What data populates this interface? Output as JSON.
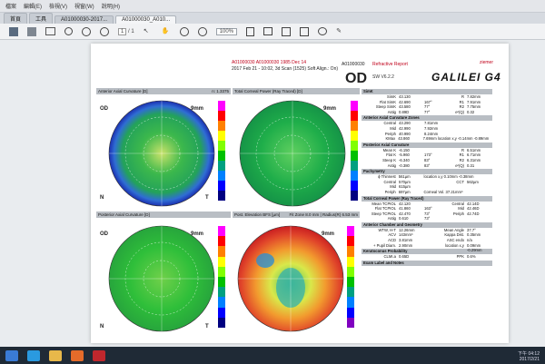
{
  "menu": {
    "items": [
      "檔案",
      "編輯(E)",
      "檢視(V)",
      "視窗(W)",
      "說明(H)"
    ]
  },
  "tabs": [
    {
      "label": "首頁"
    },
    {
      "label": "工具"
    },
    {
      "label": "A01000030-2017..."
    },
    {
      "label": "A01000030_A010..."
    }
  ],
  "toolbar": {
    "zoom_value": "100%",
    "page_current": "1",
    "page_total": "1"
  },
  "header": {
    "patient_line1": "A01000030 A01000030 1985 Dec 14",
    "patient_line2": "2017 Feb 21 - 10:02, 3d Scan (1525) Soft Align.: On)",
    "patient_id": "A01000030",
    "report_title": "Refractive Report",
    "eye": "OD",
    "sw_version": "SW V6.2.2",
    "brand": "GALILEI G4",
    "brand_sub": "ziemer"
  },
  "panels": [
    {
      "title": "Anterior Axial Curvature [D]",
      "tr": "n: 1.3375",
      "left": "OD",
      "right": "9mm",
      "bottom_left": "N",
      "bottom_right": "T"
    },
    {
      "title": "Total Corneal Power (Ray Traced) [D]",
      "tr": "",
      "left": "",
      "right": "9mm",
      "bottom_left": "",
      "bottom_right": ""
    },
    {
      "title": "Posterior Axial Curvature [D]",
      "tr": "",
      "left": "OD",
      "right": "9mm",
      "bottom_left": "N",
      "bottom_right": "T"
    },
    {
      "title": "Post. Elevation BFS [µm]",
      "tr": "Fit Zone 8.0 mm | Radius(R) 6.53 mm",
      "left": "",
      "right": "9mm",
      "bottom_left": "",
      "bottom_right": ""
    }
  ],
  "sim_k": {
    "title": "SimK",
    "tr": "n: 1.3375",
    "rows": [
      {
        "k": "SimK",
        "v": "43.130",
        "a": "",
        "k2": "R",
        "v2": "7.82mm"
      },
      {
        "k": "Flat SimK",
        "v": "42.690",
        "a": "167°",
        "k2": "R1",
        "v2": "7.91mm"
      },
      {
        "k": "Steep SimK",
        "v": "43.580",
        "a": "77°",
        "k2": "R2",
        "v2": "7.75mm"
      },
      {
        "k": "Astig",
        "v": "0.89D",
        "a": "77°",
        "k2": "e²(Q)",
        "v2": "0.32"
      }
    ]
  },
  "anterior_axial_zones": {
    "title": "Anterior Axial Curvature Zones",
    "tr": "n: 1.3375",
    "rows": [
      {
        "k": "Central",
        "v": "43.290",
        "a": "",
        "k2": "",
        "v2": "7.81mm"
      },
      {
        "k": "Mid",
        "v": "42.990",
        "a": "",
        "k2": "",
        "v2": "7.92mm"
      },
      {
        "k": "Periph",
        "v": "40.990",
        "a": "",
        "k2": "",
        "v2": "8.24mm"
      },
      {
        "k": "KMax",
        "v": "43.860",
        "a": "",
        "k2": "",
        "v2": "7.69mm  location x,y -0.14mm -0.89mm"
      }
    ]
  },
  "posterior_axial": {
    "title": "Posterior Axial Curvature",
    "rows": [
      {
        "k": "Mean K",
        "v": "-6.150",
        "a": "",
        "k2": "R",
        "v2": "6.51mm"
      },
      {
        "k": "Flat K",
        "v": "-5.960",
        "a": "173°",
        "k2": "R1",
        "v2": "6.71mm"
      },
      {
        "k": "Steep K",
        "v": "-6.340",
        "a": "83°",
        "k2": "R2",
        "v2": "6.31mm"
      },
      {
        "k": "Astig",
        "v": "-0.380",
        "a": "83°",
        "k2": "e²(Q)",
        "v2": "0.31"
      }
    ]
  },
  "pachymetry": {
    "title": "Pachymetry",
    "rows": [
      {
        "k": "ϕ Thinnest",
        "v": "561µm",
        "a": "",
        "k2": "",
        "v2": "location x,y 0.10mm -0.38mm"
      },
      {
        "k": "Central",
        "v": "570µm",
        "a": "",
        "k2": "CCT",
        "v2": "562µm"
      },
      {
        "k": "Mid",
        "v": "615µm",
        "a": "",
        "k2": "",
        "v2": ""
      },
      {
        "k": "Periph",
        "v": "697µm",
        "a": "",
        "k2": "",
        "v2": "Corneal Vol. 37.21mm³"
      }
    ]
  },
  "total_corneal_power": {
    "title": "Total Corneal Power (Ray Traced)",
    "rows": [
      {
        "k": "Mean TCPIOL",
        "v": "42.120",
        "a": "",
        "k2": "Central",
        "v2": "42.14D"
      },
      {
        "k": "Flat TCPIOL",
        "v": "41.860",
        "a": "163°",
        "k2": "Mid",
        "v2": "42.46D"
      },
      {
        "k": "Steep TCPIOL",
        "v": "42.470",
        "a": "73°",
        "k2": "Periph",
        "v2": "42.74D"
      },
      {
        "k": "Astig",
        "v": "0.610",
        "a": "73°",
        "k2": "",
        "v2": ""
      }
    ]
  },
  "anterior_chamber": {
    "title": "Anterior Chamber and Geometry",
    "rows": [
      {
        "k": "WTW, H-T",
        "v": "12.26mm",
        "a": "",
        "k2": "Mean Angle",
        "v2": "37.7°"
      },
      {
        "k": "ACV",
        "v": "143mm³",
        "a": "",
        "k2": "Kappa Dist.",
        "v2": "0.35mm"
      },
      {
        "k": "ACD",
        "v": "3.81mm",
        "a": "",
        "k2": "ASC endo",
        "v2": "n/a"
      },
      {
        "k": "+ Pupil Diam.",
        "v": "2.90mm",
        "a": "",
        "k2": "location x,y",
        "v2": "0.09mm -0.29mm"
      }
    ]
  },
  "keratoconus": {
    "title": "Keratoconus Probability",
    "rows": [
      {
        "k": "CLMI.a",
        "v": "0.65D",
        "a": "",
        "k2": "PPK",
        "v2": "0.6%"
      }
    ]
  },
  "footer_section": {
    "title": "Exam Label and Notes"
  },
  "taskbar": {
    "time": "下午 04:12",
    "date": "2017/2/21"
  }
}
